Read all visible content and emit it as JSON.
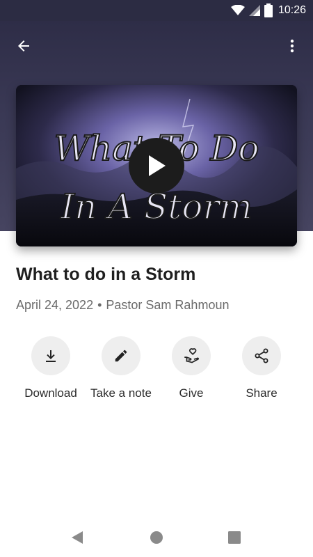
{
  "status_bar": {
    "time": "10:26"
  },
  "video": {
    "thumbnail_text_line1": "What To Do",
    "thumbnail_text_line2": "In A Storm"
  },
  "sermon": {
    "title": "What to do in a Storm",
    "date": "April 24, 2022",
    "separator": "•",
    "speaker": "Pastor Sam Rahmoun"
  },
  "actions": [
    {
      "label": "Download",
      "icon": "download-icon"
    },
    {
      "label": "Take a note",
      "icon": "pencil-icon"
    },
    {
      "label": "Give",
      "icon": "give-hand-heart-icon"
    },
    {
      "label": "Share",
      "icon": "share-icon"
    }
  ],
  "colors": {
    "header_background": "#2e2d47",
    "action_circle": "#eeeeee",
    "title_text": "#1f1f1f",
    "meta_text": "#6b6b6b"
  }
}
